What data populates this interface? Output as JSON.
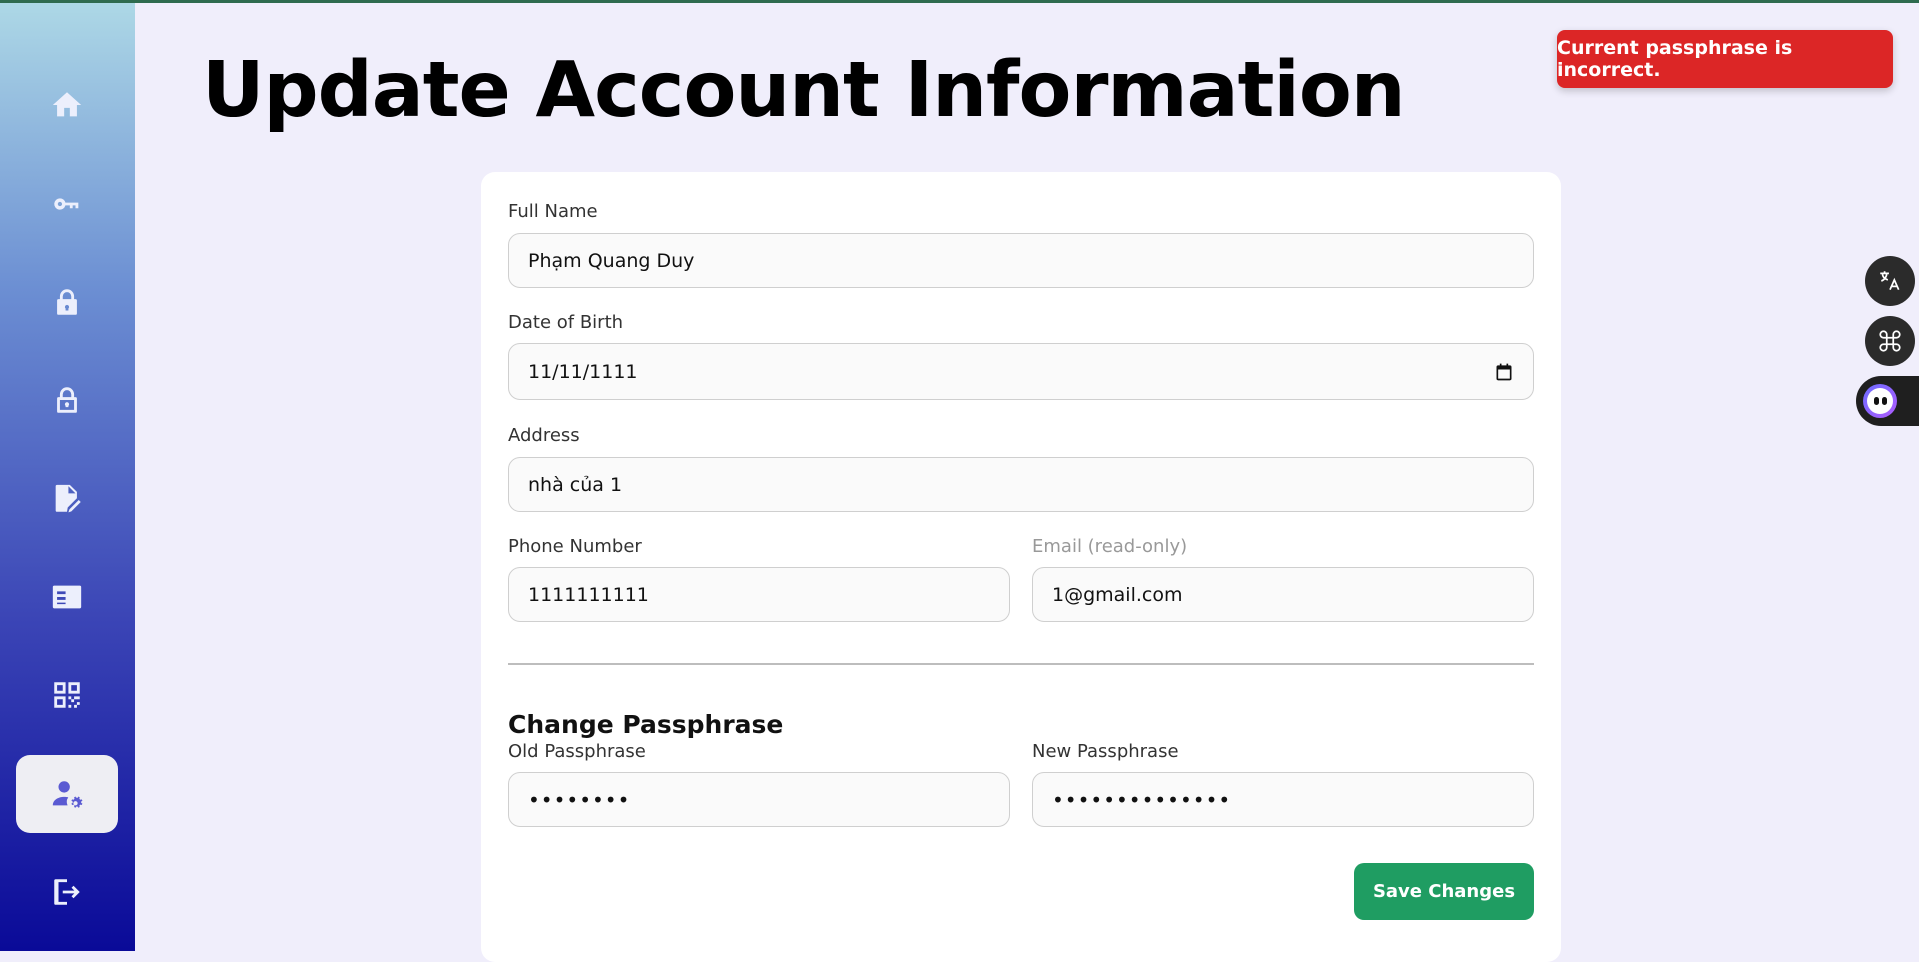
{
  "sidebar": {
    "items": [
      {
        "icon": "home-icon",
        "label": "Home"
      },
      {
        "icon": "key-icon",
        "label": "Keys"
      },
      {
        "icon": "lock-icon",
        "label": "Encrypt"
      },
      {
        "icon": "unlock-icon",
        "label": "Decrypt"
      },
      {
        "icon": "sign-document-icon",
        "label": "Sign"
      },
      {
        "icon": "verify-list-icon",
        "label": "Verify"
      },
      {
        "icon": "qr-code-icon",
        "label": "QR Code"
      },
      {
        "icon": "user-settings-icon",
        "label": "Account",
        "active": true
      },
      {
        "icon": "logout-icon",
        "label": "Logout"
      }
    ],
    "active_color": "#5a5ad2"
  },
  "page": {
    "title": "Update Account Information"
  },
  "form": {
    "full_name": {
      "label": "Full Name",
      "value": "Phạm Quang Duy"
    },
    "dob": {
      "label": "Date of Birth",
      "value": "11/11/1111"
    },
    "address": {
      "label": "Address",
      "value": "nhà của 1"
    },
    "phone": {
      "label": "Phone Number",
      "value": "1111111111"
    },
    "email": {
      "label": "Email (read-only)",
      "value": "1@gmail.com"
    },
    "passphrase_section": "Change Passphrase",
    "old_passphrase": {
      "label": "Old Passphrase",
      "value": "••••••••"
    },
    "new_passphrase": {
      "label": "New Passphrase",
      "value": "••••••••••••••"
    },
    "save_label": "Save Changes"
  },
  "toast": {
    "message": "Current passphrase is incorrect.",
    "color": "#dc2626"
  },
  "widgets": {
    "translate_icon": "translate-icon",
    "command_icon": "command-icon",
    "assistant_icon": "assistant-icon"
  },
  "colors": {
    "save_button": "#1f9d62",
    "background": "#f0eefb"
  }
}
